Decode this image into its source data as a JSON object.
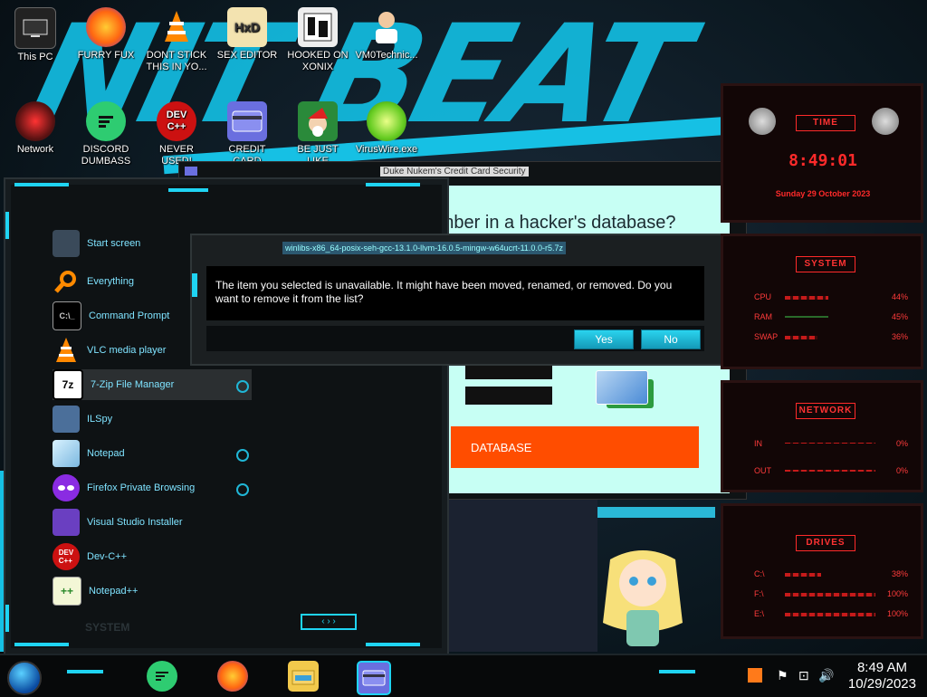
{
  "colors": {
    "accent_cyan": "#1fd4f3",
    "gadget_red": "#ff2a2a",
    "orange": "#ff4d00",
    "mint": "#c7fff4"
  },
  "wallpaper": {
    "graffiti_text": "NIT BEAT"
  },
  "desktop_icons": [
    {
      "label": "This PC",
      "icon": "computer-icon"
    },
    {
      "label": "FURRY FUX",
      "icon": "firefox-icon"
    },
    {
      "label": "DONT STICK THIS IN YO...",
      "icon": "vlc-icon"
    },
    {
      "label": "SEX EDITOR",
      "icon": "hex-editor-icon"
    },
    {
      "label": "HOOKED ON XONIX",
      "icon": "xonix-icon"
    },
    {
      "label": "VM0Technic...",
      "icon": "doctor-icon"
    },
    {
      "label": "Network",
      "icon": "network-icon"
    },
    {
      "label": "DISCORD DUMBASS",
      "icon": "chat-icon"
    },
    {
      "label": "NEVER USED!",
      "icon": "dev-cpp-icon"
    },
    {
      "label": "CREDIT CARD",
      "icon": "credit-card-icon"
    },
    {
      "label": "BE JUST LIKE",
      "icon": "santa-icon"
    },
    {
      "label": "VirusWire.exe",
      "icon": "lime-icon"
    }
  ],
  "start_menu": {
    "items": [
      {
        "label": "Start screen",
        "icon": "start-screen-icon"
      },
      {
        "label": "Everything",
        "icon": "search-icon"
      },
      {
        "label": "Command Prompt",
        "icon": "cmd-icon"
      },
      {
        "label": "VLC media player",
        "icon": "vlc-icon"
      },
      {
        "label": "7-Zip File Manager",
        "icon": "7zip-icon"
      },
      {
        "label": "ILSpy",
        "icon": "ilspy-icon"
      },
      {
        "label": "Notepad",
        "icon": "notepad-icon"
      },
      {
        "label": "Firefox Private Browsing",
        "icon": "firefox-private-icon"
      },
      {
        "label": "Visual Studio Installer",
        "icon": "visual-studio-icon"
      },
      {
        "label": "Dev-C++",
        "icon": "dev-cpp-icon"
      },
      {
        "label": "Notepad++",
        "icon": "notepad-plus-plus-icon"
      }
    ],
    "bottom_label": "SYSTEM"
  },
  "credit_window": {
    "title": "Duke Nukem's Credit Card Security",
    "question": "Is your credit card number in a hacker's database?",
    "button_text": "DATABASE"
  },
  "dialog": {
    "title": "winlibs-x86_64-posix-seh-gcc-13.1.0-llvm-16.0.5-mingw-w64ucrt-11.0.0-r5.7z",
    "message": "The item you selected is unavailable.  It might have been moved, renamed, or removed.  Do you want to remove it from the list?",
    "yes_label": "Yes",
    "no_label": "No"
  },
  "gadgets": {
    "time": {
      "title": "TIME",
      "clock": "8:49:01",
      "date": "Sunday 29 October 2023"
    },
    "system": {
      "title": "SYSTEM",
      "rows": [
        {
          "label": "CPU",
          "value": "44%"
        },
        {
          "label": "RAM",
          "value": "45%"
        },
        {
          "label": "SWAP",
          "value": "36%"
        }
      ]
    },
    "network": {
      "title": "NETWORK",
      "rows": [
        {
          "label": "IN",
          "value": "0%"
        },
        {
          "label": "OUT",
          "value": "0%"
        }
      ]
    },
    "drives": {
      "title": "DRIVES",
      "rows": [
        {
          "label": "C:\\",
          "value": "38%"
        },
        {
          "label": "F:\\",
          "value": "100%"
        },
        {
          "label": "E:\\",
          "value": "100%"
        }
      ]
    }
  },
  "taskbar": {
    "time": "8:49 AM",
    "date": "10/29/2023",
    "apps": [
      "chat-icon",
      "firefox-icon",
      "file-explorer-icon",
      "credit-card-icon"
    ]
  }
}
